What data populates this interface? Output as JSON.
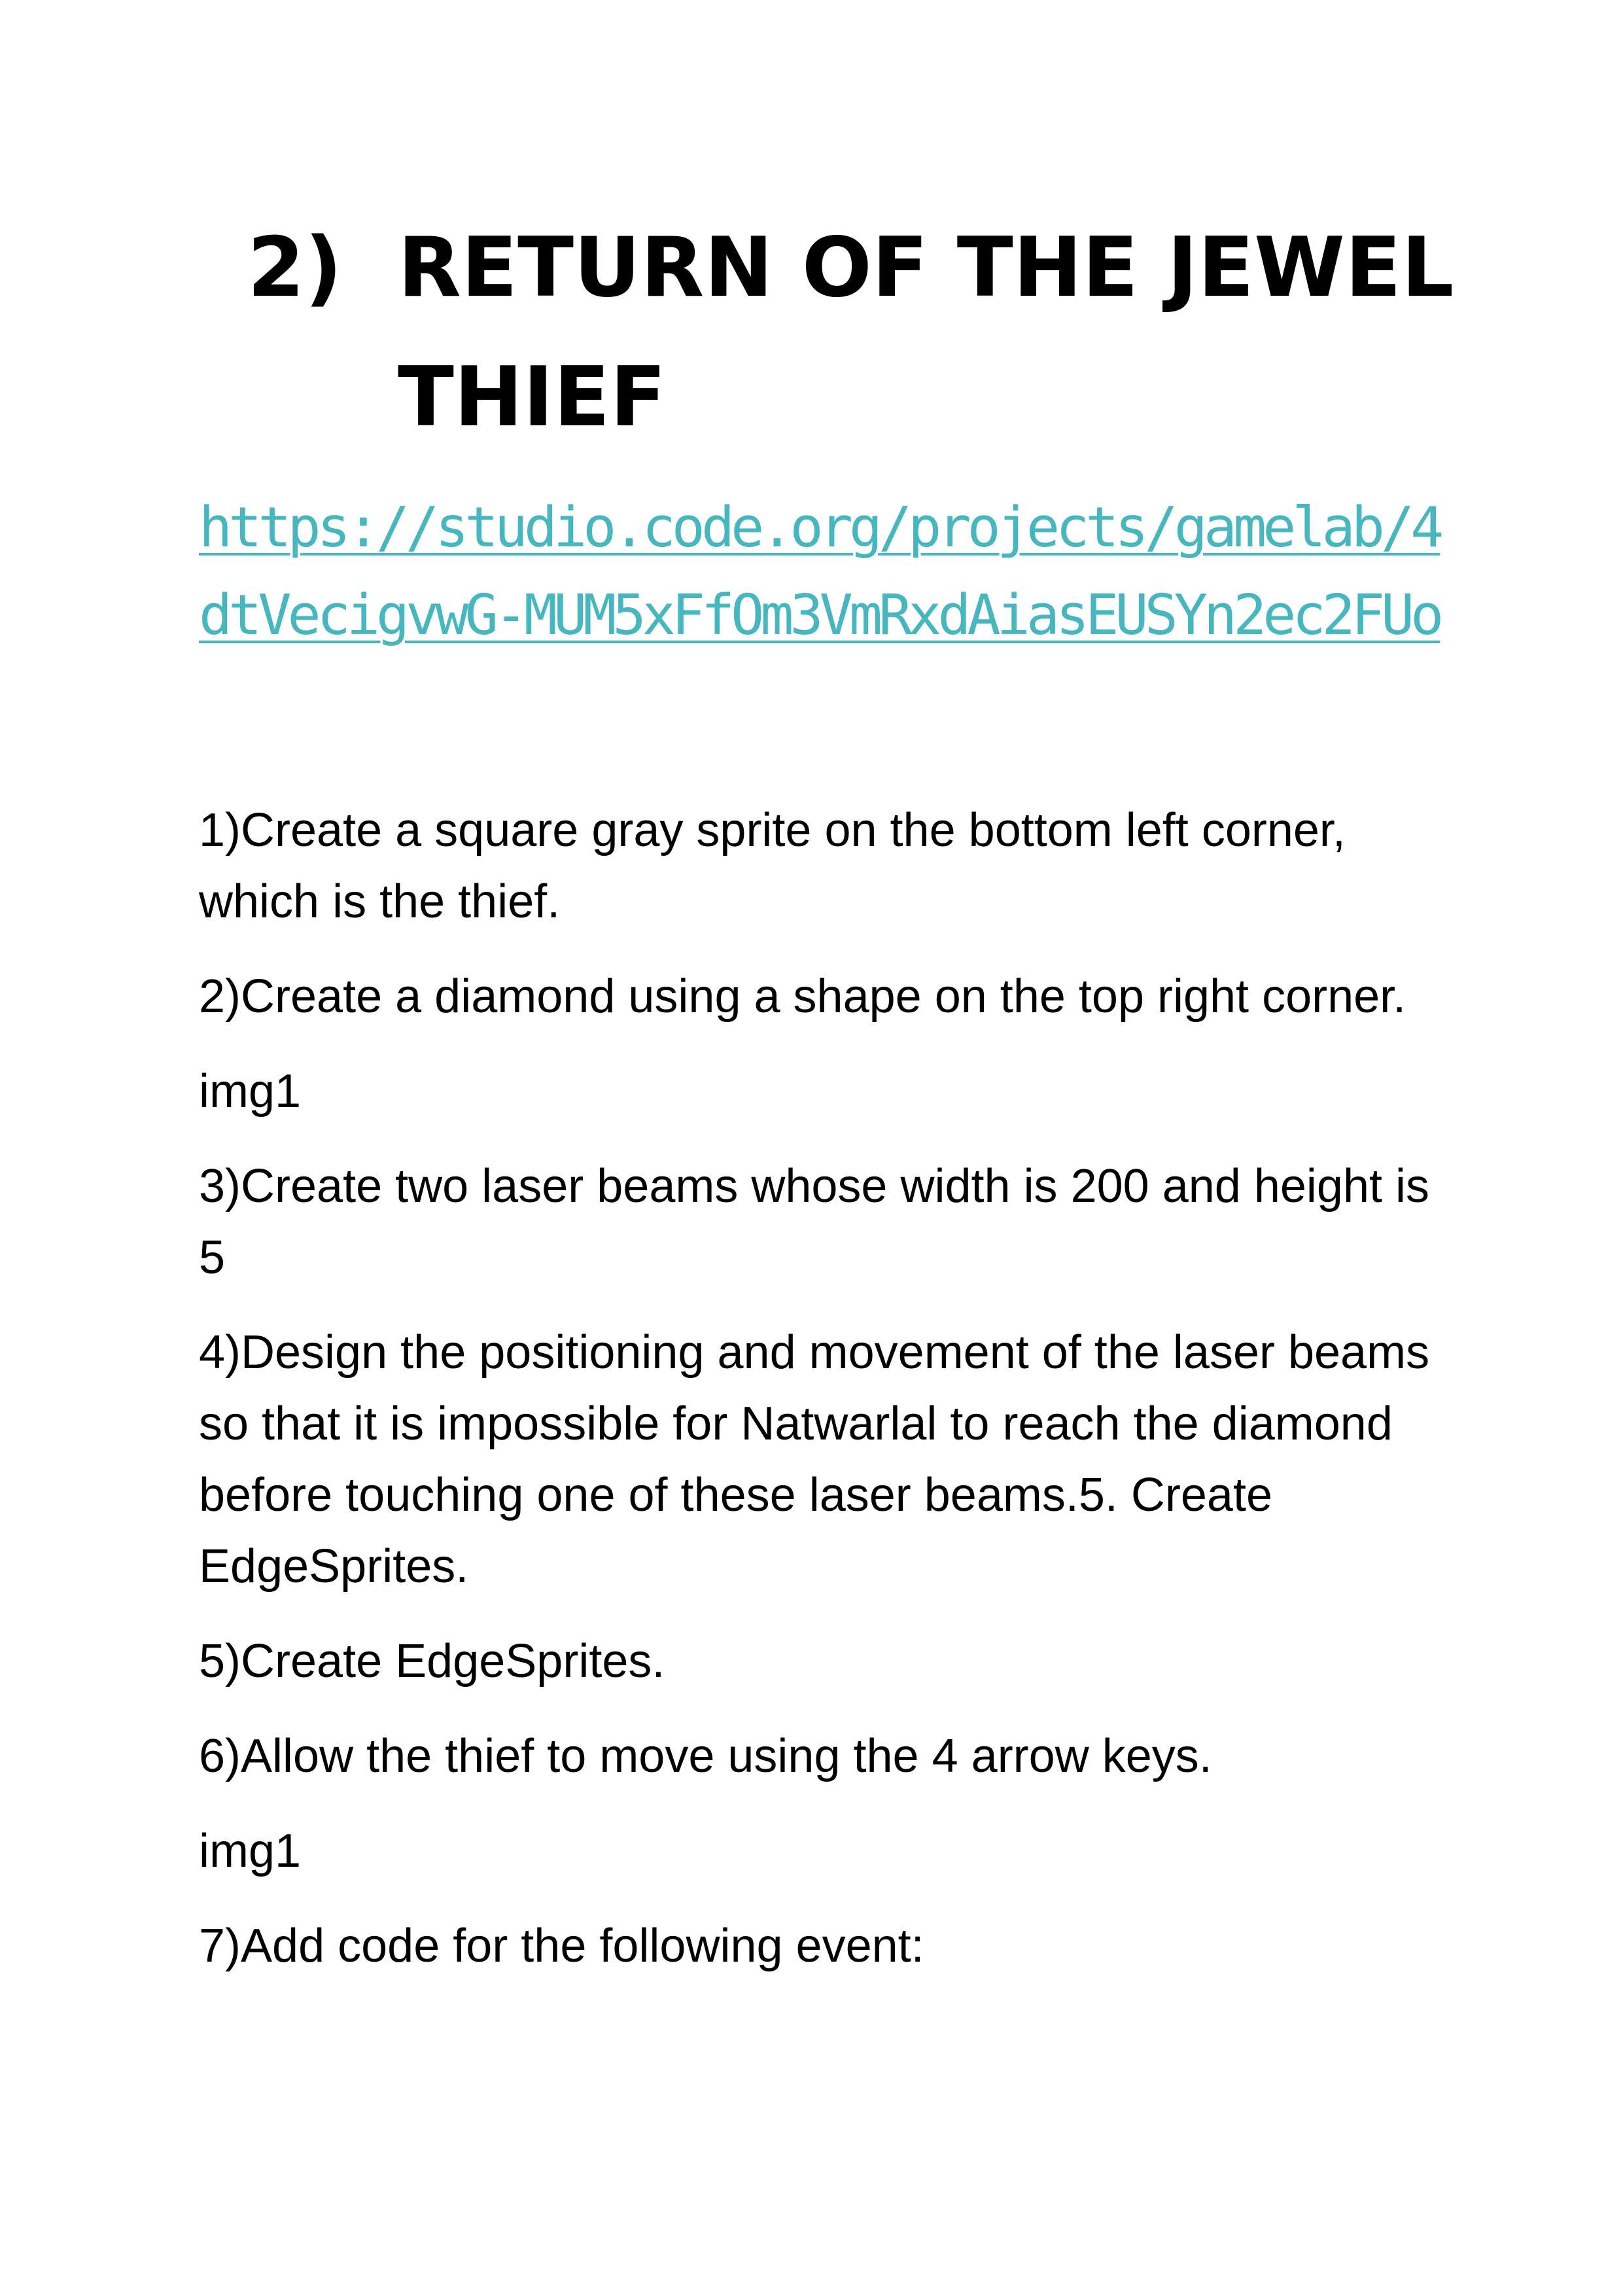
{
  "heading": {
    "number": "2)",
    "title": "RETURN OF THE JEWEL THIEF"
  },
  "link": {
    "text": "https://studio.code.org/projects/gamelab/4dtVecigvwG-MUM5xFfOm3VmRxdAiasEUSYn2ec2FUo"
  },
  "steps": [
    "1)Create a square gray sprite on the bottom left corner, which is the thief.",
    "2)Create a diamond using a shape on the top right corner.",
    "img1",
    "3)Create two laser beams whose width is 200 and height is 5",
    "4)Design the positioning and movement of the laser beams so that it is impossible for Natwarlal to reach the diamond before touching one of these laser beams.5. Create EdgeSprites.",
    "5)Create EdgeSprites.",
    "6)Allow the thief to move using the 4 arrow keys.",
    "img1",
    "7)Add code for the following event:"
  ],
  "colors": {
    "link": "#46b6bf",
    "text": "#000000",
    "background": "#ffffff"
  }
}
